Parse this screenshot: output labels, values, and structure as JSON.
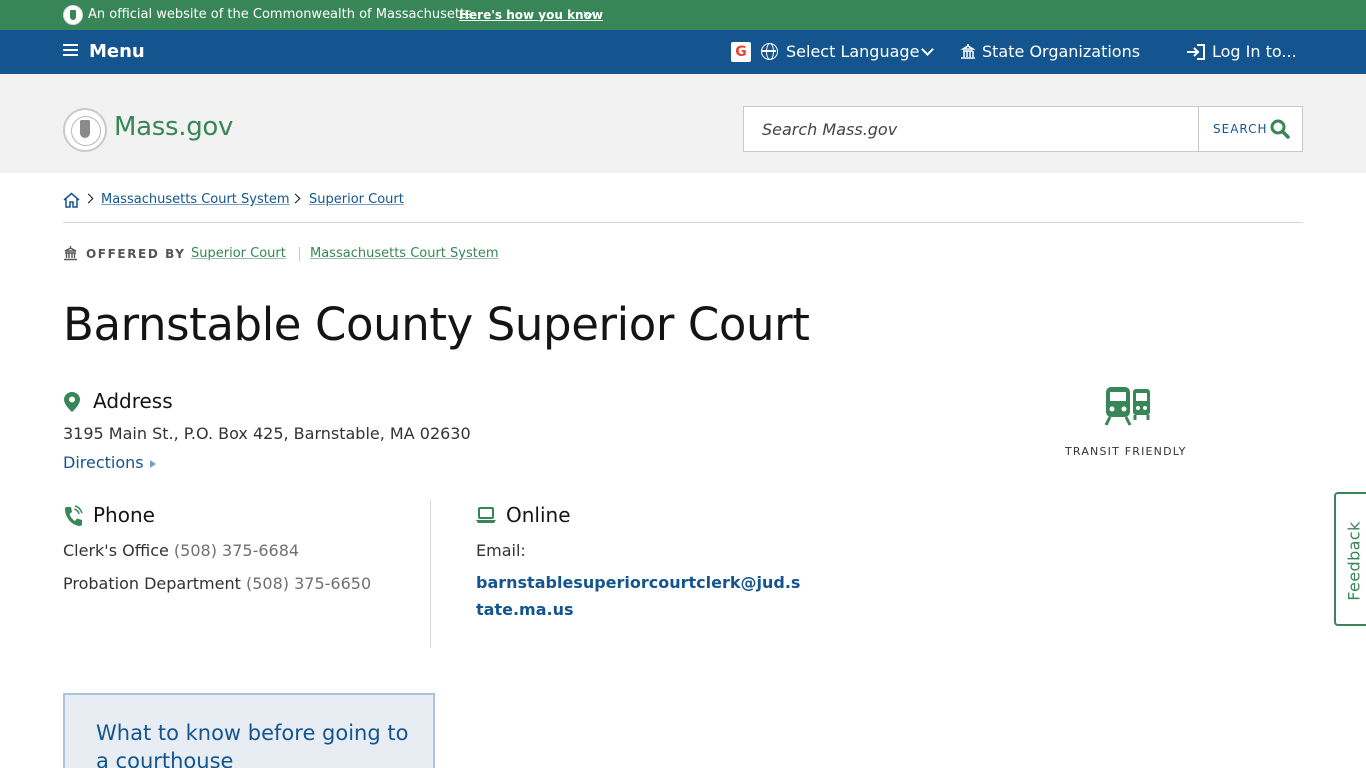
{
  "official_banner": {
    "text": "An official website of the Commonwealth of Massachusetts",
    "how_link": "Here's how you know"
  },
  "utility_nav": {
    "menu_label": "Menu",
    "language_label": "Select Language",
    "state_orgs_label": "State Organizations",
    "login_label": "Log In to..."
  },
  "header": {
    "brand": "Mass.gov",
    "search_placeholder": "Search Mass.gov",
    "search_button": "SEARCH"
  },
  "breadcrumb": {
    "items": [
      "Massachusetts Court System",
      "Superior Court"
    ]
  },
  "offered_by": {
    "label": "OFFERED BY",
    "orgs": [
      "Superior Court",
      "Massachusetts Court System"
    ]
  },
  "page": {
    "title": "Barnstable County Superior Court"
  },
  "address": {
    "heading": "Address",
    "value": "3195 Main St., P.O. Box 425, Barnstable, MA 02630",
    "directions_label": "Directions"
  },
  "transit": {
    "label": "TRANSIT FRIENDLY"
  },
  "phone": {
    "heading": "Phone",
    "entries": [
      {
        "label": "Clerk's Office",
        "number": "(508) 375-6684"
      },
      {
        "label": "Probation Department",
        "number": "(508) 375-6650"
      }
    ]
  },
  "online": {
    "heading": "Online",
    "email_label": "Email:",
    "email": "barnstablesuperiorcourtclerk@jud.state.ma.us"
  },
  "feedback": {
    "label": "Feedback"
  },
  "callout": {
    "text": "What to know before going to a courthouse"
  },
  "colors": {
    "green": "#388557",
    "blue": "#14558f",
    "header_bg": "#f2f2f2"
  }
}
